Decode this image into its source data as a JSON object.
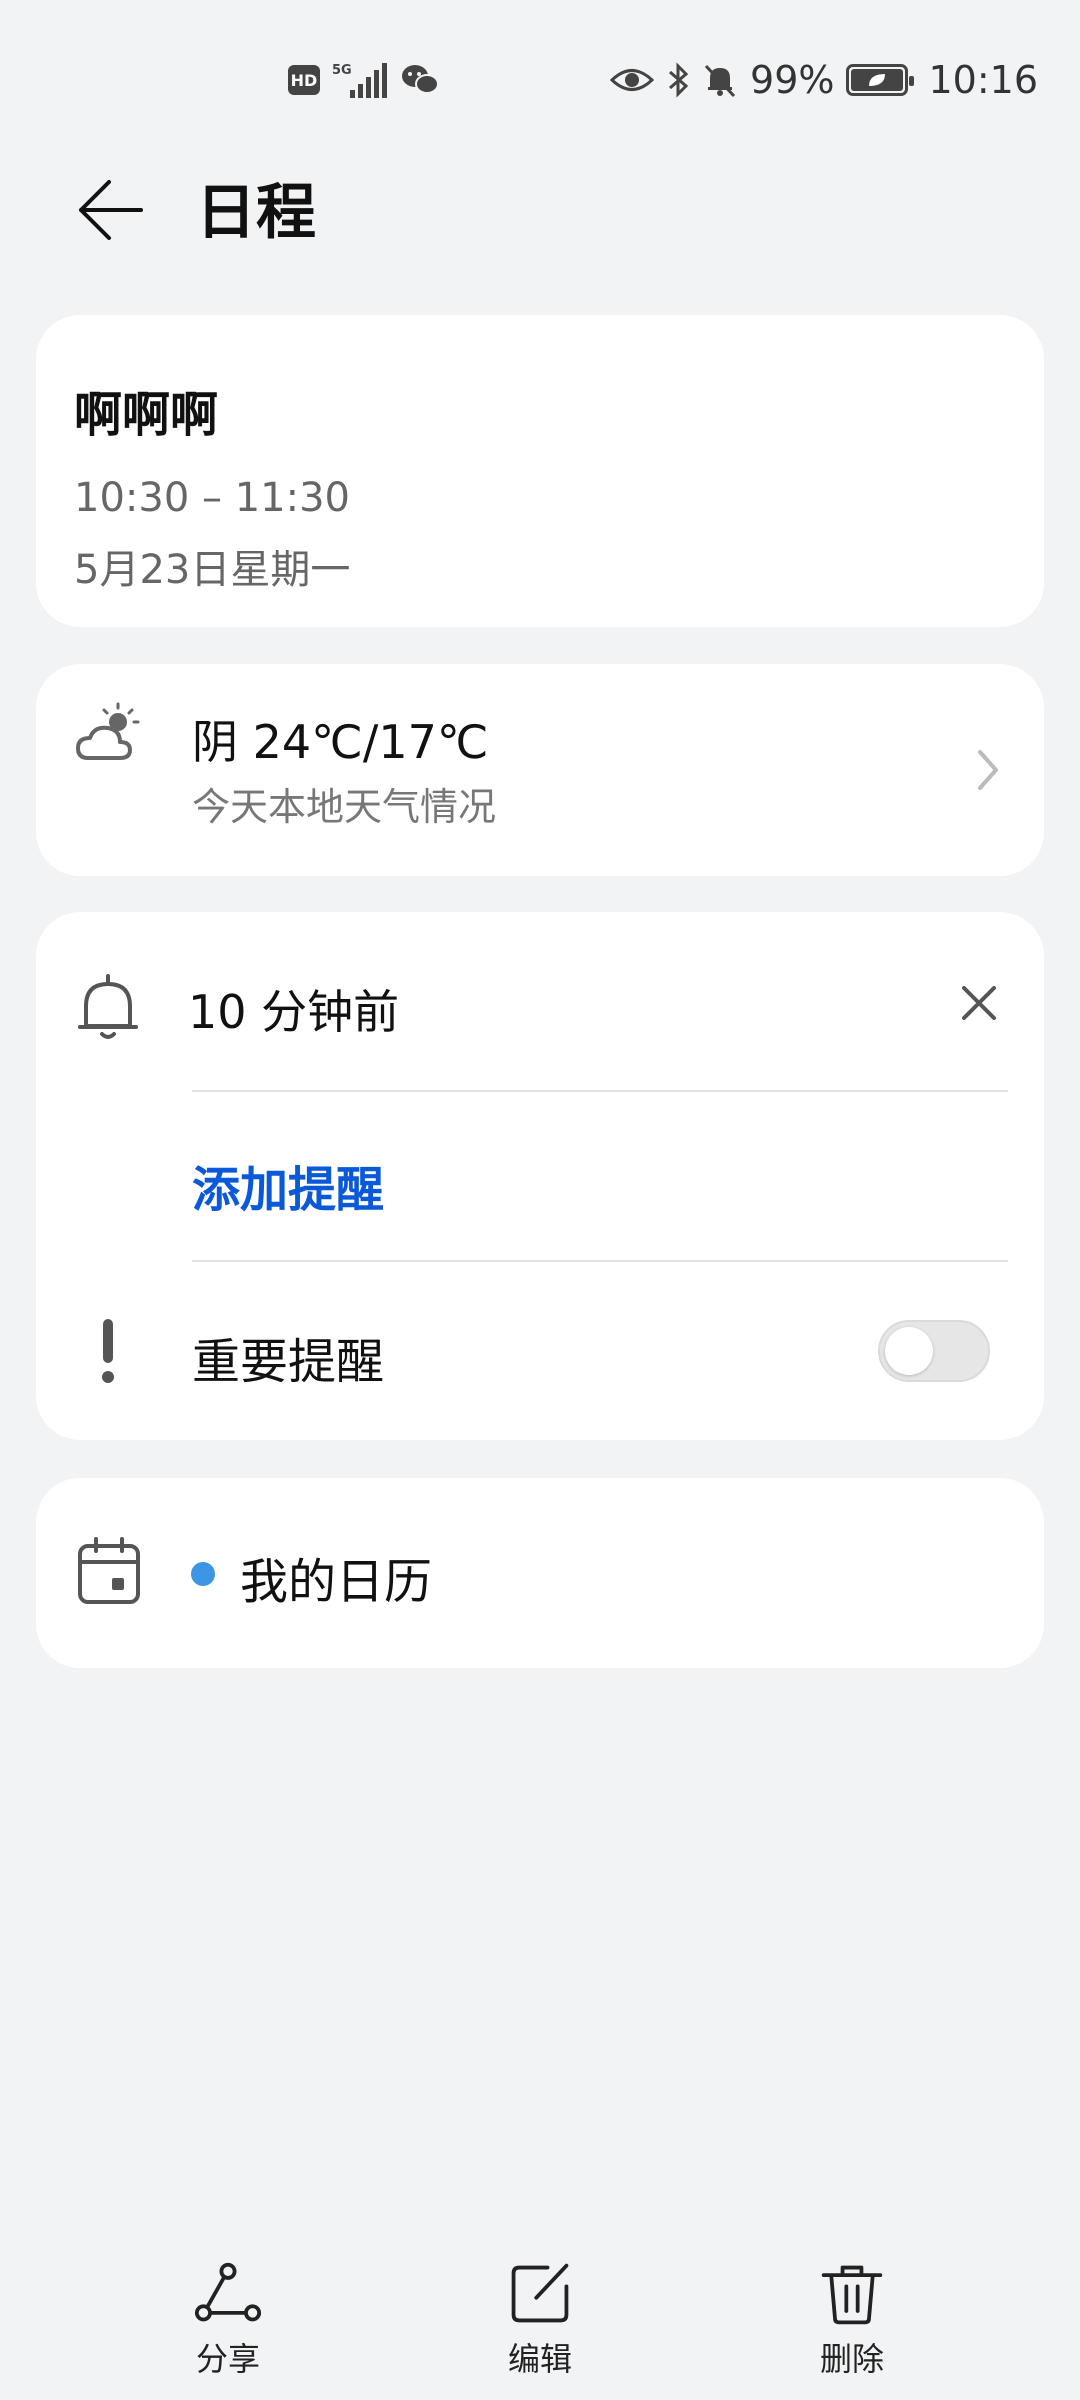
{
  "status_bar": {
    "left_icons": [
      "hd-icon",
      "signal-5g-icon",
      "wechat-icon"
    ],
    "hd": "HD",
    "network": "5G",
    "right_icons": [
      "eye-icon",
      "bluetooth-icon",
      "bell-off-icon",
      "battery-icon"
    ],
    "battery": "99%",
    "time": "10:16"
  },
  "header": {
    "title": "日程"
  },
  "event": {
    "title": "啊啊啊",
    "time": "10:30 – 11:30",
    "date": "5月23日星期一"
  },
  "weather": {
    "icon": "cloudy-sun-icon",
    "main": "阴 24℃/17℃",
    "sub": "今天本地天气情况"
  },
  "reminders": {
    "items": [
      {
        "label": "10 分钟前"
      }
    ],
    "add_label": "添加提醒",
    "important_label": "重要提醒",
    "important_on": false
  },
  "calendar": {
    "name": "我的日历",
    "color": "#3d95e5"
  },
  "bottom_bar": {
    "share": "分享",
    "edit": "编辑",
    "delete": "删除"
  }
}
